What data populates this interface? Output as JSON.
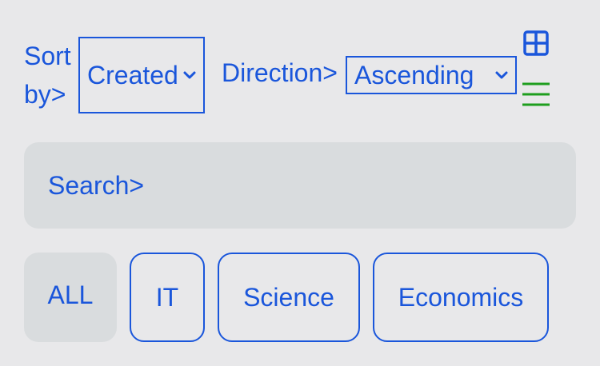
{
  "toolbar": {
    "sort_label": "Sort by>",
    "sort_value": "Created",
    "direction_label": "Direction>",
    "direction_value": "Ascending",
    "icons": [
      "grid-icon",
      "list-icon"
    ],
    "colors": {
      "accent": "#1a56db",
      "list_icon": "#1e9e1e"
    }
  },
  "search": {
    "label": "Search>"
  },
  "filters": {
    "active": "ALL",
    "chips": [
      "ALL",
      "IT",
      "Science",
      "Economics"
    ]
  }
}
